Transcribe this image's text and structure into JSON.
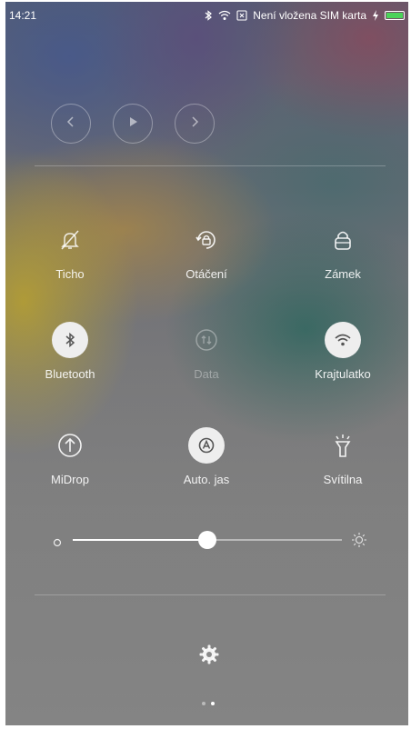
{
  "status_bar": {
    "time": "14:21",
    "sim_text": "Není vložena SIM karta",
    "battery_color": "#4bd35a"
  },
  "media": {
    "prev_icon": "chevron-left-icon",
    "play_icon": "play-icon",
    "next_icon": "chevron-right-icon"
  },
  "toggles": {
    "row1": [
      {
        "label": "Ticho",
        "icon": "bell-off-icon",
        "active": false
      },
      {
        "label": "Otáčení",
        "icon": "rotation-lock-icon",
        "active": false
      },
      {
        "label": "Zámek",
        "icon": "lock-icon",
        "active": false
      }
    ],
    "row2": [
      {
        "label": "Bluetooth",
        "icon": "bluetooth-icon",
        "active": true
      },
      {
        "label": "Data",
        "icon": "mobile-data-icon",
        "active": false,
        "disabled": true
      },
      {
        "label": "Krajtulatko",
        "icon": "wifi-icon",
        "active": true
      }
    ],
    "row3": [
      {
        "label": "MiDrop",
        "icon": "upload-icon",
        "active": false
      },
      {
        "label": "Auto. jas",
        "icon": "auto-brightness-icon",
        "active": true
      },
      {
        "label": "Svítilna",
        "icon": "flashlight-icon",
        "active": false
      }
    ]
  },
  "brightness": {
    "level": 0.5
  },
  "page_indicator": {
    "pages": 2,
    "current": 2
  }
}
